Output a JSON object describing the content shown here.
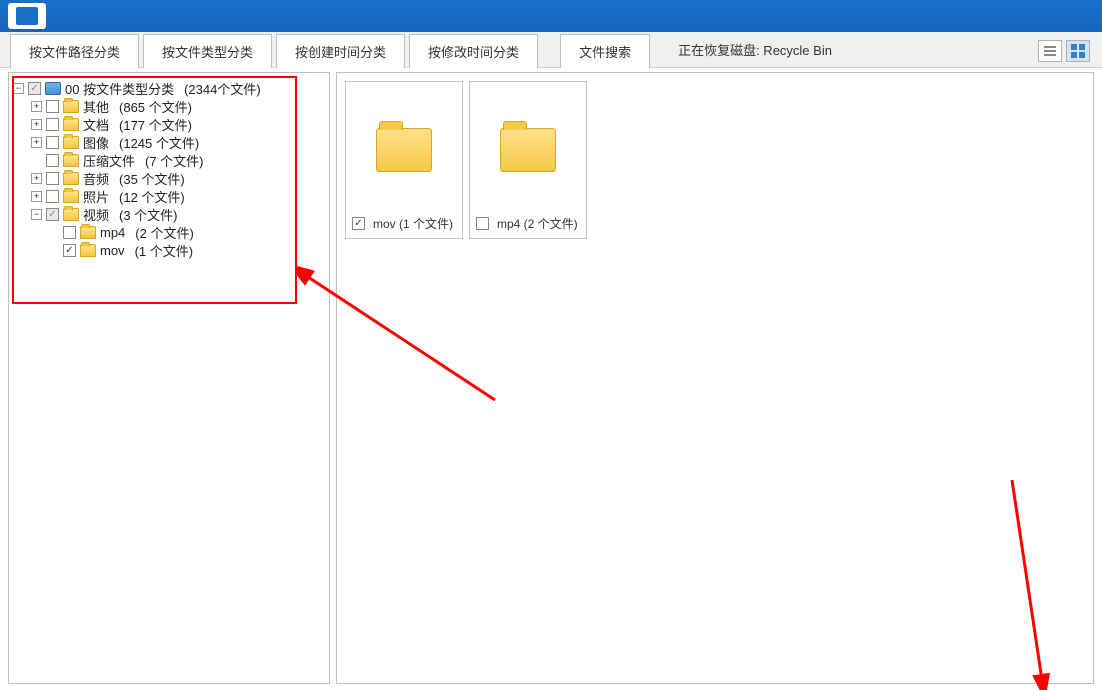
{
  "header": {
    "title": ""
  },
  "tabs": [
    {
      "label": "按文件路径分类"
    },
    {
      "label": "按文件类型分类"
    },
    {
      "label": "按创建时间分类"
    },
    {
      "label": "按修改时间分类"
    },
    {
      "label": "文件搜索"
    }
  ],
  "status": "正在恢复磁盘: Recycle Bin",
  "tree": {
    "root": {
      "label": "00  按文件类型分类",
      "count": "(2344个文件)"
    },
    "children": [
      {
        "label": "其他",
        "count": "(865 个文件)"
      },
      {
        "label": "文档",
        "count": "(177 个文件)"
      },
      {
        "label": "图像",
        "count": "(1245 个文件)"
      },
      {
        "label": "压缩文件",
        "count": "(7 个文件)"
      },
      {
        "label": "音频",
        "count": "(35 个文件)"
      },
      {
        "label": "照片",
        "count": "(12 个文件)"
      },
      {
        "label": "视频",
        "count": "(3 个文件)"
      }
    ],
    "sub": [
      {
        "label": "mp4",
        "count": "(2 个文件)"
      },
      {
        "label": "mov",
        "count": "(1 个文件)"
      }
    ]
  },
  "thumbs": [
    {
      "label": "mov  (1 个文件)",
      "checked": true
    },
    {
      "label": "mp4  (2 个文件)",
      "checked": false
    }
  ]
}
